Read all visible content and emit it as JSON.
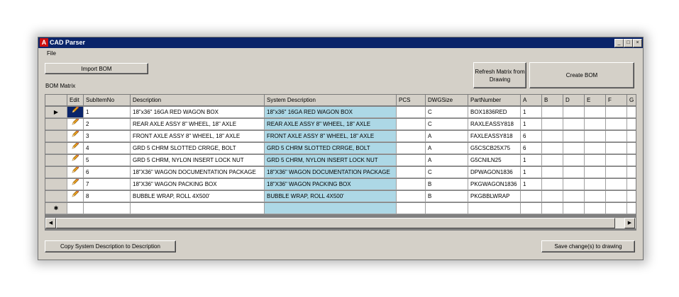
{
  "window": {
    "title": "CAD Parser",
    "app_icon": "A"
  },
  "titlebar_buttons": {
    "minimize": "_",
    "maximize": "□",
    "close": "×"
  },
  "menu": {
    "file": "File"
  },
  "buttons": {
    "import_bom": "Import BOM",
    "refresh_matrix": "Refresh Matrix from Drawing",
    "create_bom": "Create BOM",
    "copy_system_description": "Copy System Description to Description",
    "save_changes": "Save change(s) to drawing"
  },
  "labels": {
    "bom_matrix": "BOM Matrix"
  },
  "grid": {
    "columns": [
      "Edit",
      "SubItemNo",
      "Description",
      "System Description",
      "PCS",
      "DWGSize",
      "PartNumber",
      "A",
      "B",
      "D",
      "E",
      "F",
      "G"
    ],
    "current_row_marker": "▶",
    "new_row_marker": "✱",
    "rows": [
      [
        "1",
        "18\"x36\" 16GA RED WAGON BOX",
        "18\"x36\" 16GA RED WAGON BOX",
        "",
        "C",
        "BOX1836RED",
        "1",
        "",
        "",
        "",
        "",
        ""
      ],
      [
        "2",
        "REAR AXLE ASSY 8\" WHEEL, 18\" AXLE",
        "REAR AXLE ASSY 8\" WHEEL, 18\" AXLE",
        "",
        "C",
        "RAXLEASSY818",
        "1",
        "",
        "",
        "",
        "",
        ""
      ],
      [
        "3",
        "FRONT AXLE ASSY 8\" WHEEL, 18\" AXLE",
        "FRONT AXLE ASSY 8\" WHEEL, 18\" AXLE",
        "",
        "A",
        "FAXLEASSY818",
        "6",
        "",
        "",
        "",
        "",
        ""
      ],
      [
        "4",
        "GRD 5 CHRM SLOTTED CRRGE, BOLT",
        "GRD 5 CHRM SLOTTED CRRGE, BOLT",
        "",
        "A",
        "G5CSCB25X75",
        "6",
        "",
        "",
        "",
        "",
        ""
      ],
      [
        "5",
        "GRD 5 CHRM, NYLON INSERT LOCK NUT",
        "GRD 5 CHRM, NYLON INSERT LOCK NUT",
        "",
        "A",
        "G5CNILN25",
        "1",
        "",
        "",
        "",
        "",
        ""
      ],
      [
        "6",
        "18\"X36\" WAGON DOCUMENTATION PACKAGE",
        "18\"X36\" WAGON DOCUMENTATION PACKAGE",
        "",
        "C",
        "DPWAGON1836",
        "1",
        "",
        "",
        "",
        "",
        ""
      ],
      [
        "7",
        "18\"X36\" WAGON PACKING BOX",
        "18\"X36\" WAGON PACKING BOX",
        "",
        "B",
        "PKGWAGON1836",
        "1",
        "",
        "",
        "",
        "",
        ""
      ],
      [
        "8",
        "BUBBLE WRAP, ROLL 4X500'",
        "BUBBLE WRAP, ROLL 4X500'",
        "",
        "B",
        "PKGBBLWRAP",
        "",
        "",
        "",
        "",
        "",
        ""
      ]
    ]
  },
  "scrollbar": {
    "left_arrow": "◀",
    "right_arrow": "▶"
  },
  "icons": {
    "row_edit": "pencil-icon",
    "app": "app-icon"
  },
  "colors": {
    "titlebar": "#0a246a",
    "system_description_fill": "#add8e6",
    "window_face": "#d4d0c8",
    "grid_empty": "#808080"
  }
}
